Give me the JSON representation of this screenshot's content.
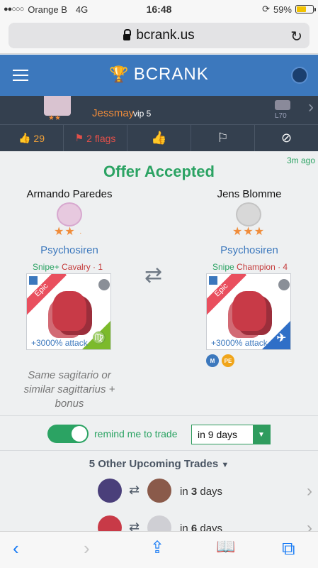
{
  "status_bar": {
    "signal": "●●○○○",
    "carrier": "Orange B",
    "network": "4G",
    "time": "16:48",
    "battery_text": "59%",
    "battery_level": 0.59
  },
  "browser": {
    "url": "bcrank.us"
  },
  "header": {
    "brand": "BCRANK"
  },
  "offer_bar": {
    "user_name": "Jessmay",
    "vip": "vip 5",
    "level": "L70",
    "likes": "29",
    "flags": "2 flags"
  },
  "offer": {
    "time_ago": "3m ago",
    "title": "Offer Accepted",
    "left": {
      "user": "Armando Paredes",
      "stars": "★★",
      "hero": "Psychosiren",
      "tag1": "Snipe+",
      "tag2": "Cavalry · 1",
      "rarity": "Epic",
      "attack": "+3000% attack",
      "element_symbol": "♍"
    },
    "right": {
      "user": "Jens Blomme",
      "stars": "★★★",
      "hero": "Psychosiren",
      "tag1": "Snipe",
      "tag2": "Champion · 4",
      "rarity": "Epic",
      "attack": "+3000% attack",
      "element_symbol": "✈",
      "chip1": "M",
      "chip2": "PE"
    },
    "comment": "Same sagitario or similar sagittarius + bonus"
  },
  "remind": {
    "label": "remind me to trade",
    "selected": "in 9 days"
  },
  "upcoming": {
    "title": "5 Other Upcoming Trades",
    "rows": [
      {
        "prefix": "in ",
        "count": "3",
        "suffix": " days"
      },
      {
        "prefix": "in ",
        "count": "6",
        "suffix": " days"
      }
    ]
  },
  "toolbar": {
    "back": "‹",
    "forward": "›",
    "share": "⇪",
    "bookmarks": "📖",
    "tabs": "⧉"
  }
}
